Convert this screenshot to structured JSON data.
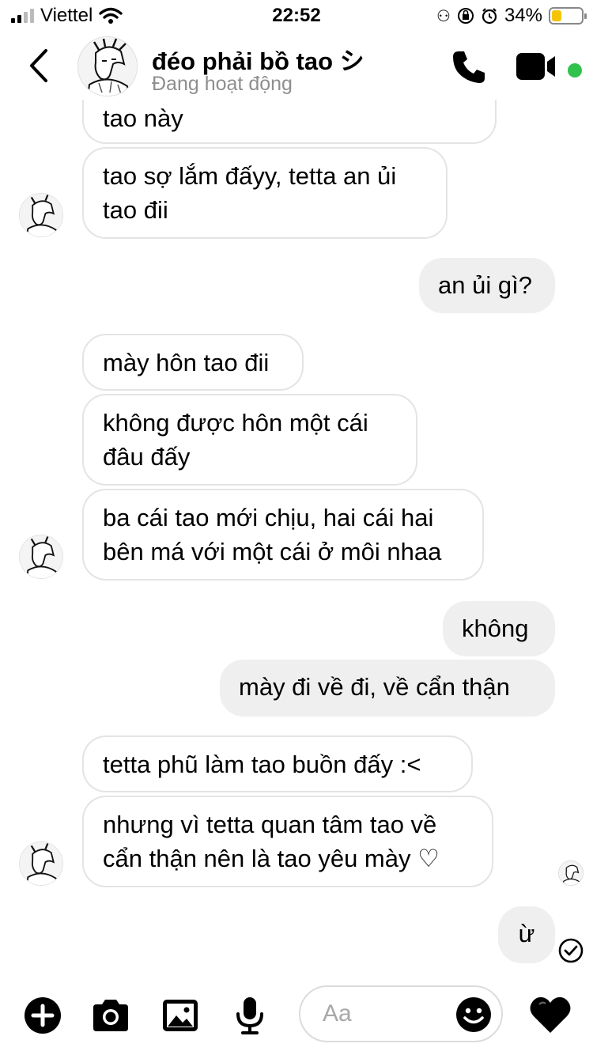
{
  "status_bar": {
    "carrier": "Viettel",
    "time": "22:52",
    "battery": "34%",
    "battery_level": 0.34,
    "battery_color": "#f5c400"
  },
  "header": {
    "contact_name": "đéo phải bồ tao シ",
    "contact_status": "Đang hoạt động",
    "back_icon": "chevron-left-icon",
    "call_icon": "phone-icon",
    "video_icon": "video-camera-icon",
    "online_color": "#31c24d"
  },
  "messages": [
    {
      "dir": "in",
      "text": "tao này"
    },
    {
      "dir": "in",
      "text": "tao sợ lắm đấyy, tetta an ủi\ntao đii"
    },
    {
      "dir": "out",
      "text": "an ủi gì?"
    },
    {
      "dir": "in",
      "text": "mày hôn tao đii"
    },
    {
      "dir": "in",
      "text": "không được hôn một cái\nđâu đấy"
    },
    {
      "dir": "in",
      "text": "ba cái tao mới chịu, hai cái hai\nbên má với một cái ở môi nhaa"
    },
    {
      "dir": "out",
      "text": "không"
    },
    {
      "dir": "out",
      "text": "mày đi về đi, về cẩn thận"
    },
    {
      "dir": "in",
      "text": "tetta phũ làm tao buồn đấy :<"
    },
    {
      "dir": "in",
      "text": "nhưng vì tetta quan tâm tao về\ncẩn thận nên là tao yêu mày ♡"
    },
    {
      "dir": "out",
      "text": "ừ"
    }
  ],
  "composer": {
    "placeholder": "Aa",
    "add_icon": "plus-circle-icon",
    "camera_icon": "camera-icon",
    "gallery_icon": "image-icon",
    "mic_icon": "microphone-icon",
    "emoji_icon": "smiley-icon",
    "like_icon": "heart-icon"
  }
}
